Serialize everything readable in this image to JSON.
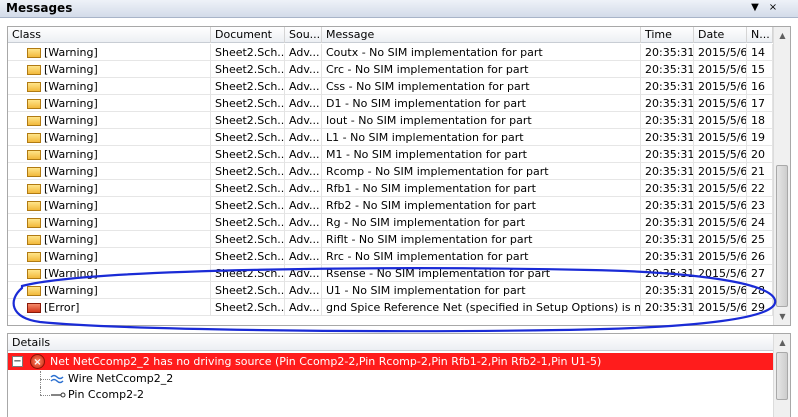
{
  "window": {
    "title": "Messages",
    "buttons": [
      "▼",
      "×"
    ]
  },
  "table": {
    "columns": [
      "Class",
      "Document",
      "Sou...",
      "Message",
      "Time",
      "Date",
      "N..."
    ],
    "rows": [
      {
        "class": "[Warning]",
        "kind": "warning",
        "document": "Sheet2.Sch...",
        "source": "Adv...",
        "message": "Coutx - No SIM implementation for part",
        "time": "20:35:31",
        "date": "2015/5/6",
        "no": "14"
      },
      {
        "class": "[Warning]",
        "kind": "warning",
        "document": "Sheet2.Sch...",
        "source": "Adv...",
        "message": "Crc - No SIM implementation for part",
        "time": "20:35:31",
        "date": "2015/5/6",
        "no": "15"
      },
      {
        "class": "[Warning]",
        "kind": "warning",
        "document": "Sheet2.Sch...",
        "source": "Adv...",
        "message": "Css - No SIM implementation for part",
        "time": "20:35:31",
        "date": "2015/5/6",
        "no": "16"
      },
      {
        "class": "[Warning]",
        "kind": "warning",
        "document": "Sheet2.Sch...",
        "source": "Adv...",
        "message": "D1 - No SIM implementation for part",
        "time": "20:35:31",
        "date": "2015/5/6",
        "no": "17"
      },
      {
        "class": "[Warning]",
        "kind": "warning",
        "document": "Sheet2.Sch...",
        "source": "Adv...",
        "message": "Iout - No SIM implementation for part",
        "time": "20:35:31",
        "date": "2015/5/6",
        "no": "18"
      },
      {
        "class": "[Warning]",
        "kind": "warning",
        "document": "Sheet2.Sch...",
        "source": "Adv...",
        "message": "L1 - No SIM implementation for part",
        "time": "20:35:31",
        "date": "2015/5/6",
        "no": "19"
      },
      {
        "class": "[Warning]",
        "kind": "warning",
        "document": "Sheet2.Sch...",
        "source": "Adv...",
        "message": "M1 - No SIM implementation for part",
        "time": "20:35:31",
        "date": "2015/5/6",
        "no": "20"
      },
      {
        "class": "[Warning]",
        "kind": "warning",
        "document": "Sheet2.Sch...",
        "source": "Adv...",
        "message": "Rcomp - No SIM implementation for part",
        "time": "20:35:31",
        "date": "2015/5/6",
        "no": "21"
      },
      {
        "class": "[Warning]",
        "kind": "warning",
        "document": "Sheet2.Sch...",
        "source": "Adv...",
        "message": "Rfb1 - No SIM implementation for part",
        "time": "20:35:31",
        "date": "2015/5/6",
        "no": "22"
      },
      {
        "class": "[Warning]",
        "kind": "warning",
        "document": "Sheet2.Sch...",
        "source": "Adv...",
        "message": "Rfb2 - No SIM implementation for part",
        "time": "20:35:31",
        "date": "2015/5/6",
        "no": "23"
      },
      {
        "class": "[Warning]",
        "kind": "warning",
        "document": "Sheet2.Sch...",
        "source": "Adv...",
        "message": "Rg - No SIM implementation for part",
        "time": "20:35:31",
        "date": "2015/5/6",
        "no": "24"
      },
      {
        "class": "[Warning]",
        "kind": "warning",
        "document": "Sheet2.Sch...",
        "source": "Adv...",
        "message": "Riflt - No SIM implementation for part",
        "time": "20:35:31",
        "date": "2015/5/6",
        "no": "25"
      },
      {
        "class": "[Warning]",
        "kind": "warning",
        "document": "Sheet2.Sch...",
        "source": "Adv...",
        "message": "Rrc - No SIM implementation for part",
        "time": "20:35:31",
        "date": "2015/5/6",
        "no": "26"
      },
      {
        "class": "[Warning]",
        "kind": "warning",
        "document": "Sheet2.Sch...",
        "source": "Adv...",
        "message": "Rsense - No SIM implementation for part",
        "time": "20:35:31",
        "date": "2015/5/6",
        "no": "27"
      },
      {
        "class": "[Warning]",
        "kind": "warning",
        "document": "Sheet2.Sch...",
        "source": "Adv...",
        "message": "U1 - No SIM implementation for part",
        "time": "20:35:31",
        "date": "2015/5/6",
        "no": "28"
      },
      {
        "class": "[Error]",
        "kind": "error",
        "document": "Sheet2.Sch...",
        "source": "Adv...",
        "message": "gnd Spice Reference Net (specified in Setup Options) is not ...",
        "time": "20:35:31",
        "date": "2015/5/6",
        "no": "29"
      }
    ]
  },
  "details": {
    "header": "Details",
    "expander": "−",
    "error_icon": "error-circle-icon",
    "error_text": "Net NetCcomp2_2 has no driving source (Pin Ccomp2-2,Pin Rcomp-2,Pin Rfb1-2,Pin Rfb2-1,Pin U1-5)",
    "children": [
      {
        "icon": "wire-icon",
        "label": "Wire NetCcomp2_2"
      },
      {
        "icon": "pin-icon",
        "label": "Pin Ccomp2-2"
      }
    ]
  },
  "colors": {
    "error_highlight": "#ff1c1c",
    "annotation_ink": "#1a2bd6",
    "warning_icon": "#f2b93b",
    "error_icon": "#d2361a"
  }
}
